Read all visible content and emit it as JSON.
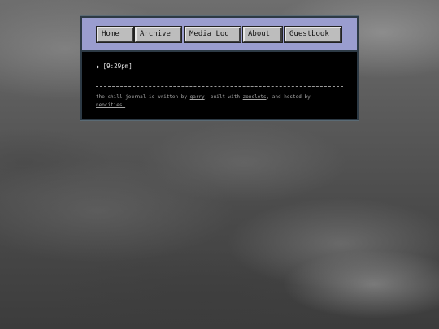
{
  "nav": {
    "items": [
      {
        "label": "Home"
      },
      {
        "label": "Archive"
      },
      {
        "label": "Media Log"
      },
      {
        "label": "About"
      },
      {
        "label": "Guestbook"
      }
    ]
  },
  "entry": {
    "marker": "▶",
    "time": "[9:29pm]"
  },
  "footer": {
    "prefix": "the chill journal is written by ",
    "author": "garry",
    "middle": ", built with ",
    "tool": "zonelets",
    "hosted_text": ", and hosted by ",
    "host": "neocities!"
  },
  "colors": {
    "navbar_bg": "#9a9dcf",
    "content_bg": "#000000",
    "button_bg": "#bdbdbd"
  }
}
